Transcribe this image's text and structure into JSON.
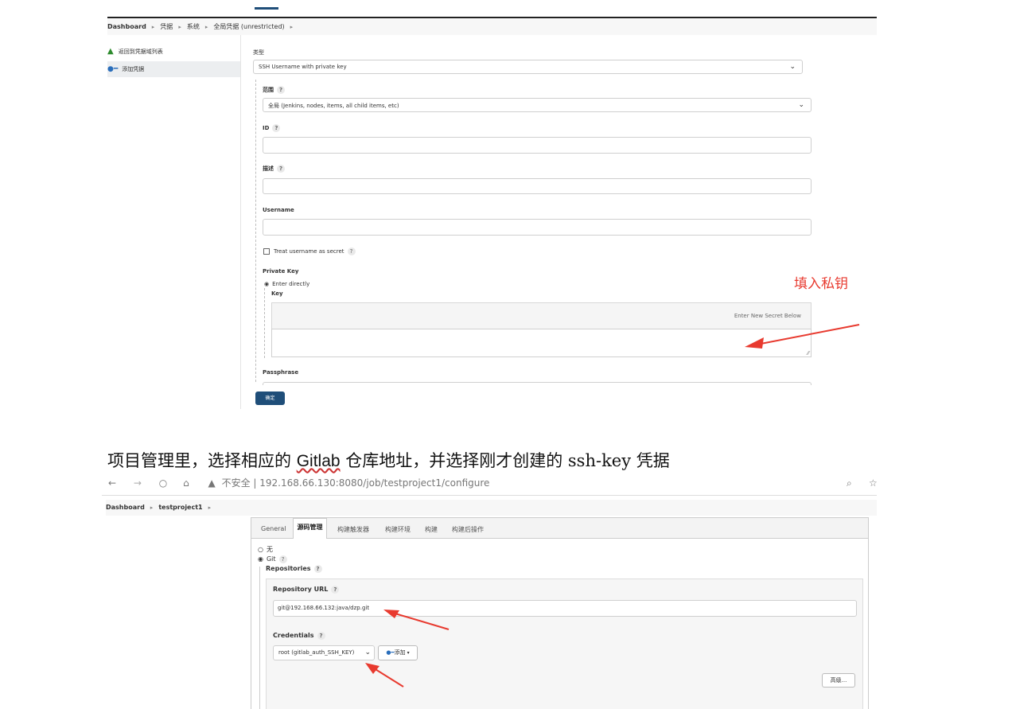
{
  "top": {
    "breadcrumb": [
      "Dashboard",
      "凭据",
      "系统",
      "全局凭据 (unrestricted)"
    ],
    "sidebar": [
      {
        "label": "返回到凭据域列表",
        "icon": "up-arrow-icon"
      },
      {
        "label": "添加凭据",
        "icon": "key-icon"
      }
    ],
    "form": {
      "kind_label": "类型",
      "kind_value": "SSH Username with private key",
      "scope_label": "范围",
      "scope_value": "全局 (Jenkins, nodes, items, all child items, etc)",
      "id_label": "ID",
      "desc_label": "描述",
      "username_label": "Username",
      "treat_secret_label": "Treat username as secret",
      "private_key_label": "Private Key",
      "enter_directly_label": "Enter directly",
      "key_label": "Key",
      "secret_placeholder": "Enter New Secret Below",
      "passphrase_label": "Passphrase",
      "confirm_button": "确定",
      "help_mark": "?"
    },
    "annotation": "填入私钥",
    "annotation_color": "#e83a2f"
  },
  "caption": {
    "part1": "项目管理里，选择相应的 ",
    "link": "Gitlab",
    "part2": " 仓库地址，并选择刚才创建的 ssh-key 凭据"
  },
  "bottom": {
    "address_bar": "不安全 | 192.168.66.130:8080/job/testproject1/configure",
    "breadcrumb": [
      "Dashboard",
      "testproject1"
    ],
    "tabs": [
      "General",
      "源码管理",
      "构建触发器",
      "构建环境",
      "构建",
      "构建后操作"
    ],
    "active_tab": "源码管理",
    "scm_none": "无",
    "scm_git": "Git",
    "repositories_label": "Repositories",
    "repo_url_label": "Repository URL",
    "repo_url_value": "git@192.168.66.132:java/dzp.git",
    "credentials_label": "Credentials",
    "credentials_value": "root (gitlab_auth_SSH_KEY)",
    "add_button": "添加",
    "advanced_button": "高级...",
    "help_mark": "?"
  }
}
